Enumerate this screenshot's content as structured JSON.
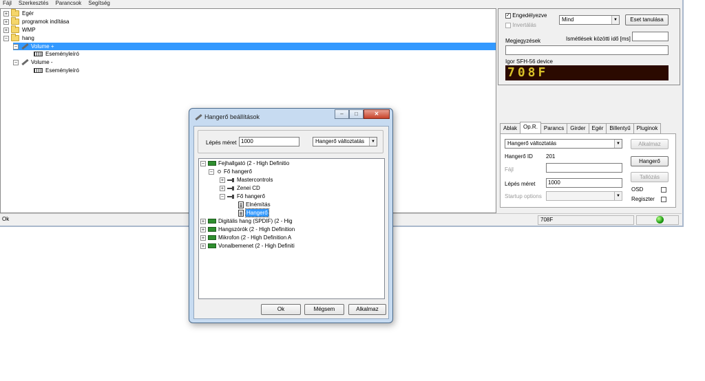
{
  "menubar": [
    "Fájl",
    "Szerkesztés",
    "Parancsok",
    "Segítség"
  ],
  "tree": {
    "items": [
      {
        "label": "Egér"
      },
      {
        "label": "programok indítása"
      },
      {
        "label": "WMP"
      },
      {
        "label": "hang"
      },
      {
        "label": "Volume +"
      },
      {
        "label": "Eseményleíró"
      },
      {
        "label": "Volume -"
      },
      {
        "label": "Eseményleíró"
      }
    ]
  },
  "side": {
    "enabled_label": "Engedélyezve",
    "invert_label": "Invertálás",
    "mode_select": "Mind",
    "learn_button": "Eset tanulása",
    "repeat_label": "Ismétlések közötti idő [ms]",
    "repeat_value": "",
    "comments_label": "Megjegyzések",
    "comments_value": "",
    "device_label": "Igor SFH-56 device",
    "led_text": "708F"
  },
  "tabs": [
    "Ablak",
    "Op.R.",
    "Parancs",
    "Girder",
    "Egér",
    "Billentyű",
    "Pluginok"
  ],
  "tab_body": {
    "action_select": "Hangerő változtatás",
    "apply_button": "Alkalmaz",
    "volume_id_label": "Hangerő ID",
    "volume_id_value": "201",
    "volume_button": "Hangerő",
    "file_label": "Fájl",
    "browse_button": "Tallózás",
    "step_label": "Lépés méret",
    "step_value": "1000",
    "startup_label": "Startup options",
    "osd_label": "OSD",
    "register_label": "Regiszter"
  },
  "status": {
    "left": "Ok",
    "code": "708F"
  },
  "dialog": {
    "title": "Hangerő beállítások",
    "step_label": "Lépés méret",
    "step_value": "1000",
    "mode_select": "Hangerő változtatás",
    "tree": [
      {
        "label": "Fejhallgató (2 - High Definitio"
      },
      {
        "label": "Fő hangerő"
      },
      {
        "label": "Mastercontrols"
      },
      {
        "label": "Zenei CD"
      },
      {
        "label": "Fő hangerő"
      },
      {
        "label": "Elnémítás"
      },
      {
        "label": "Hangerő"
      },
      {
        "label": "Digitális hang (SPDIF) (2 - Hig"
      },
      {
        "label": "Hangszórók (2 - High Definition"
      },
      {
        "label": "Mikrofon (2 - High Definition A"
      },
      {
        "label": "Vonalbemenet (2 - High Definiti"
      }
    ],
    "ok_button": "Ok",
    "cancel_button": "Mégsem",
    "apply_button": "Alkalmaz"
  }
}
